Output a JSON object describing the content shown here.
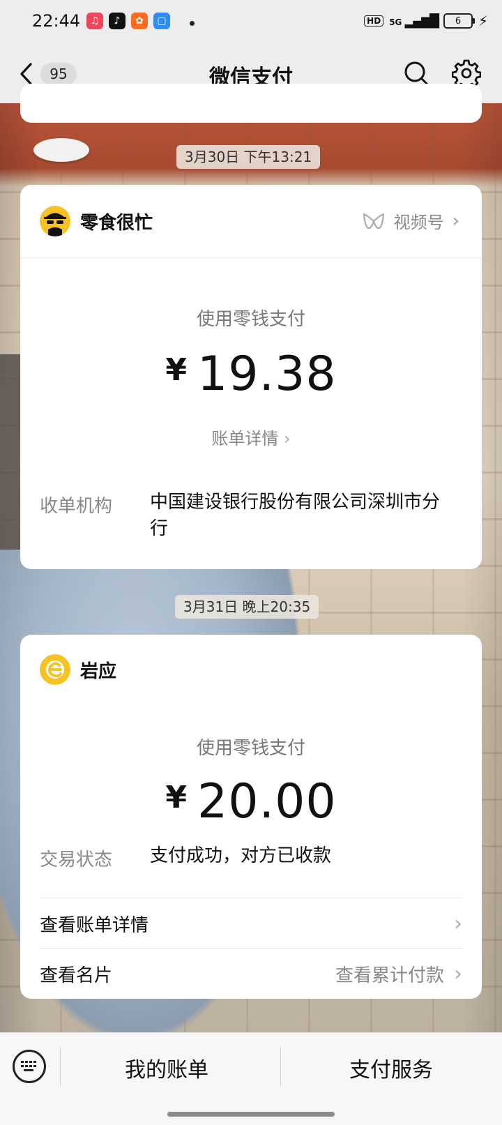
{
  "status_bar": {
    "time": "22:44",
    "apps": [
      {
        "name": "music-app-icon",
        "color": "#f0445c",
        "glyph": "♫"
      },
      {
        "name": "douyin-app-icon",
        "color": "#111111",
        "glyph": "♪"
      },
      {
        "name": "kuaishou-app-icon",
        "color": "#ff6a1f",
        "glyph": "✿"
      },
      {
        "name": "files-app-icon",
        "color": "#2f8cf0",
        "glyph": "▢"
      }
    ],
    "hd_label": "HD",
    "network": "5G",
    "battery": "6"
  },
  "nav": {
    "unread_count": "95",
    "title": "微信支付"
  },
  "messages": [
    {
      "date": "3月30日 下午13:21",
      "merchant": "零食很忙",
      "channel": "视频号",
      "pay_method": "使用零钱支付",
      "currency": "¥",
      "amount": "19.38",
      "detail_link": "账单详情",
      "field_label": "收单机构",
      "field_value": "中国建设银行股份有限公司深圳市分行"
    },
    {
      "date": "3月31日 晚上20:35",
      "merchant": "岩应",
      "pay_method": "使用零钱支付",
      "currency": "¥",
      "amount": "20.00",
      "field_label": "交易状态",
      "field_value": "支付成功，对方已收款",
      "links": [
        {
          "label": "查看账单详情",
          "right": ""
        },
        {
          "label": "查看名片",
          "right": "查看累计付款"
        }
      ]
    }
  ],
  "bottom_bar": {
    "my_bills": "我的账单",
    "pay_services": "支付服务"
  },
  "colors": {
    "accent_yellow": "#f7c224",
    "text_gray": "#888888"
  }
}
